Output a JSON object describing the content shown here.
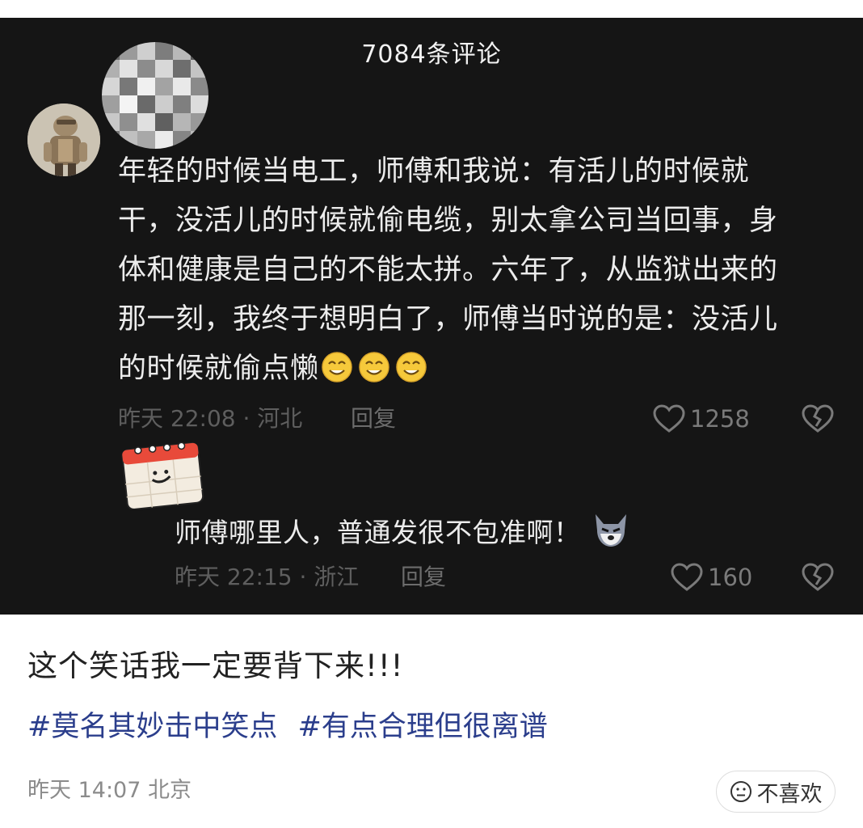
{
  "panel": {
    "header_title": "7084条评论"
  },
  "comment": {
    "lines": [
      "年轻的时候当电工，师傅和我说：有活儿的时候就",
      "干，没活儿的时候就偷电缆，别太拿公司当回事，身",
      "体和健康是自己的不能太拼。六年了，从监狱出来的",
      "那一刻，我终于想明白了，师傅当时说的是：没活儿",
      "的时候就偷点懒"
    ],
    "emoji": "smile-emoji",
    "time_location": "昨天 22:08 · 河北",
    "reply_label": "回复",
    "likes": "1258"
  },
  "reply": {
    "text": "师傅哪里人，普通发很不包准啊！",
    "emoji": "wolf-emoji",
    "time_location": "昨天 22:15 · 浙江",
    "reply_label": "回复",
    "likes": "160"
  },
  "post": {
    "caption": "这个笑话我一定要背下来!!!",
    "hashtags": [
      "#莫名其妙击中笑点",
      "#有点合理但很离谱"
    ],
    "meta": "昨天 14:07 北京",
    "dislike_label": "不喜欢"
  },
  "colors": {
    "panel_bg": "#151515",
    "hashtag": "#2b3e8c",
    "muted_gray": "#5e5e5e"
  }
}
